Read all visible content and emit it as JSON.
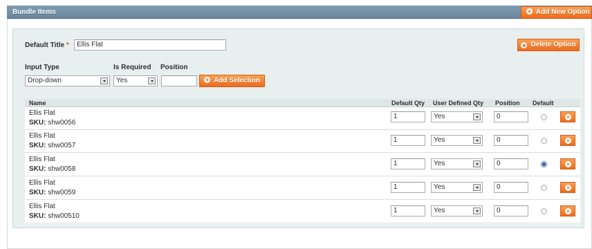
{
  "header": {
    "title": "Bundle Items",
    "add_new_option": "Add New Option"
  },
  "option": {
    "default_title_label": "Default Title",
    "required_mark": "*",
    "default_title_value": "Ellis Flat",
    "delete_option": "Delete Option",
    "input_type_label": "Input Type",
    "is_required_label": "Is Required",
    "position_label": "Position",
    "input_type_value": "Drop-down",
    "is_required_value": "Yes",
    "position_value": "",
    "add_selection": "Add Selection"
  },
  "grid": {
    "columns": [
      "Name",
      "Default Qty",
      "User Defined Qty",
      "Position",
      "Default"
    ],
    "sku_label": "SKU:",
    "rows": [
      {
        "name": "Ellis Flat",
        "sku": "shw0056",
        "qty": "1",
        "user_defined": "Yes",
        "position": "0",
        "is_default": false
      },
      {
        "name": "Ellis Flat",
        "sku": "shw0057",
        "qty": "1",
        "user_defined": "Yes",
        "position": "0",
        "is_default": false
      },
      {
        "name": "Ellis Flat",
        "sku": "shw0058",
        "qty": "1",
        "user_defined": "Yes",
        "position": "0",
        "is_default": true
      },
      {
        "name": "Ellis Flat",
        "sku": "shw0059",
        "qty": "1",
        "user_defined": "Yes",
        "position": "0",
        "is_default": false
      },
      {
        "name": "Ellis Flat",
        "sku": "shw00510",
        "qty": "1",
        "user_defined": "Yes",
        "position": "0",
        "is_default": false
      }
    ]
  },
  "icons": {
    "add": "plus-circle-icon",
    "delete": "x-circle-icon",
    "dropdown": "chevron-down-icon"
  },
  "colors": {
    "accent": "#ee6a1b",
    "header": "#7390a7",
    "panel": "#e7efef"
  }
}
